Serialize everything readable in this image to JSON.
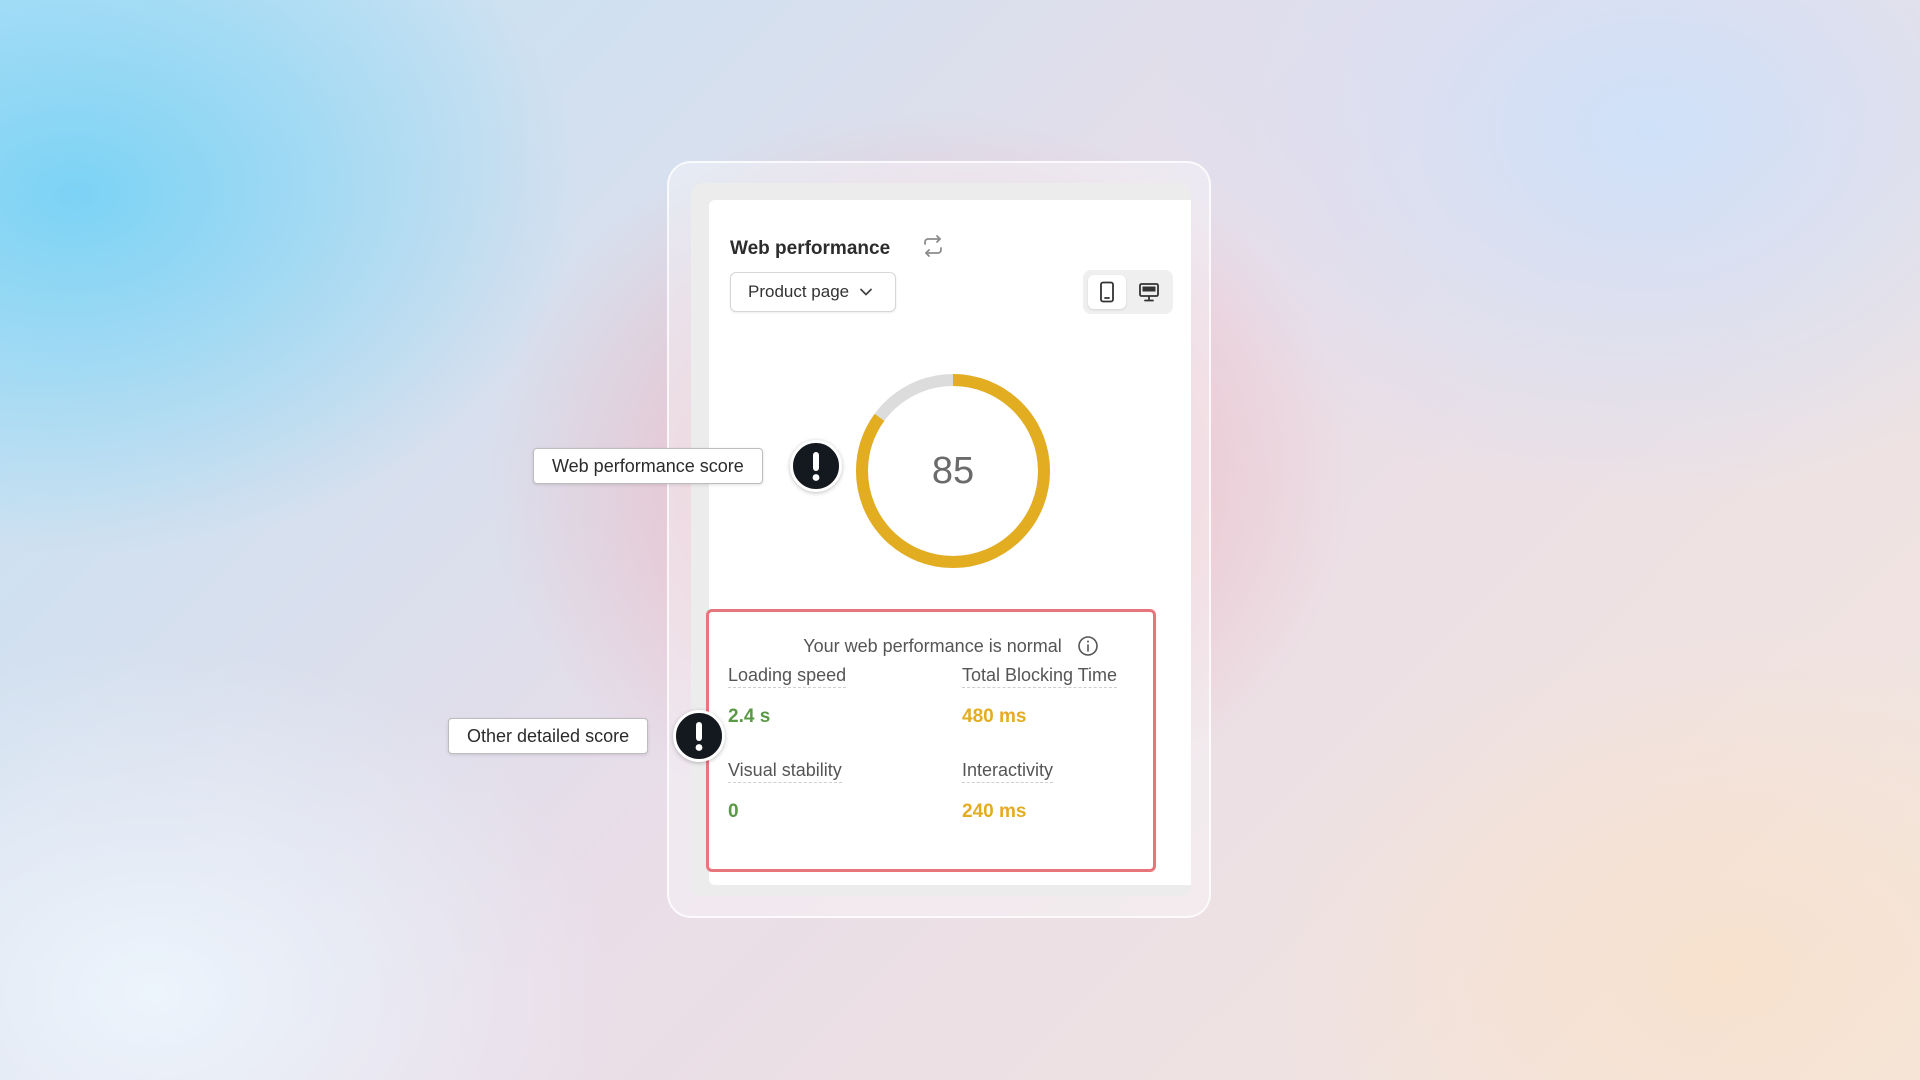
{
  "widget": {
    "title": "Web performance",
    "refresh_icon": "refresh-icon",
    "page_select": {
      "selected": "Product page",
      "icon": "chevron-down-icon"
    },
    "device_toggle": {
      "mobile_icon": "mobile-icon",
      "desktop_icon": "desktop-icon",
      "selected": "mobile"
    },
    "score": {
      "value": "85",
      "progress_percent": 85,
      "color": "#e3ad22",
      "track_color": "#dcdcdc"
    },
    "summary": {
      "status_text": "Your web performance is normal",
      "info_icon": "info-icon"
    },
    "metrics": [
      {
        "label": "Loading speed",
        "value": "2.4 s",
        "color": "#5a9a45"
      },
      {
        "label": "Total Blocking Time",
        "value": "480 ms",
        "color": "#e3ad22"
      },
      {
        "label": "Visual stability",
        "value": "0",
        "color": "#5a9a45"
      },
      {
        "label": "Interactivity",
        "value": "240 ms",
        "color": "#e3ad22"
      }
    ]
  },
  "callouts": {
    "score_label": "Web performance score",
    "detail_label": "Other detailed score",
    "icon": "exclamation-icon"
  },
  "colors": {
    "highlight_border": "#e8757c"
  }
}
